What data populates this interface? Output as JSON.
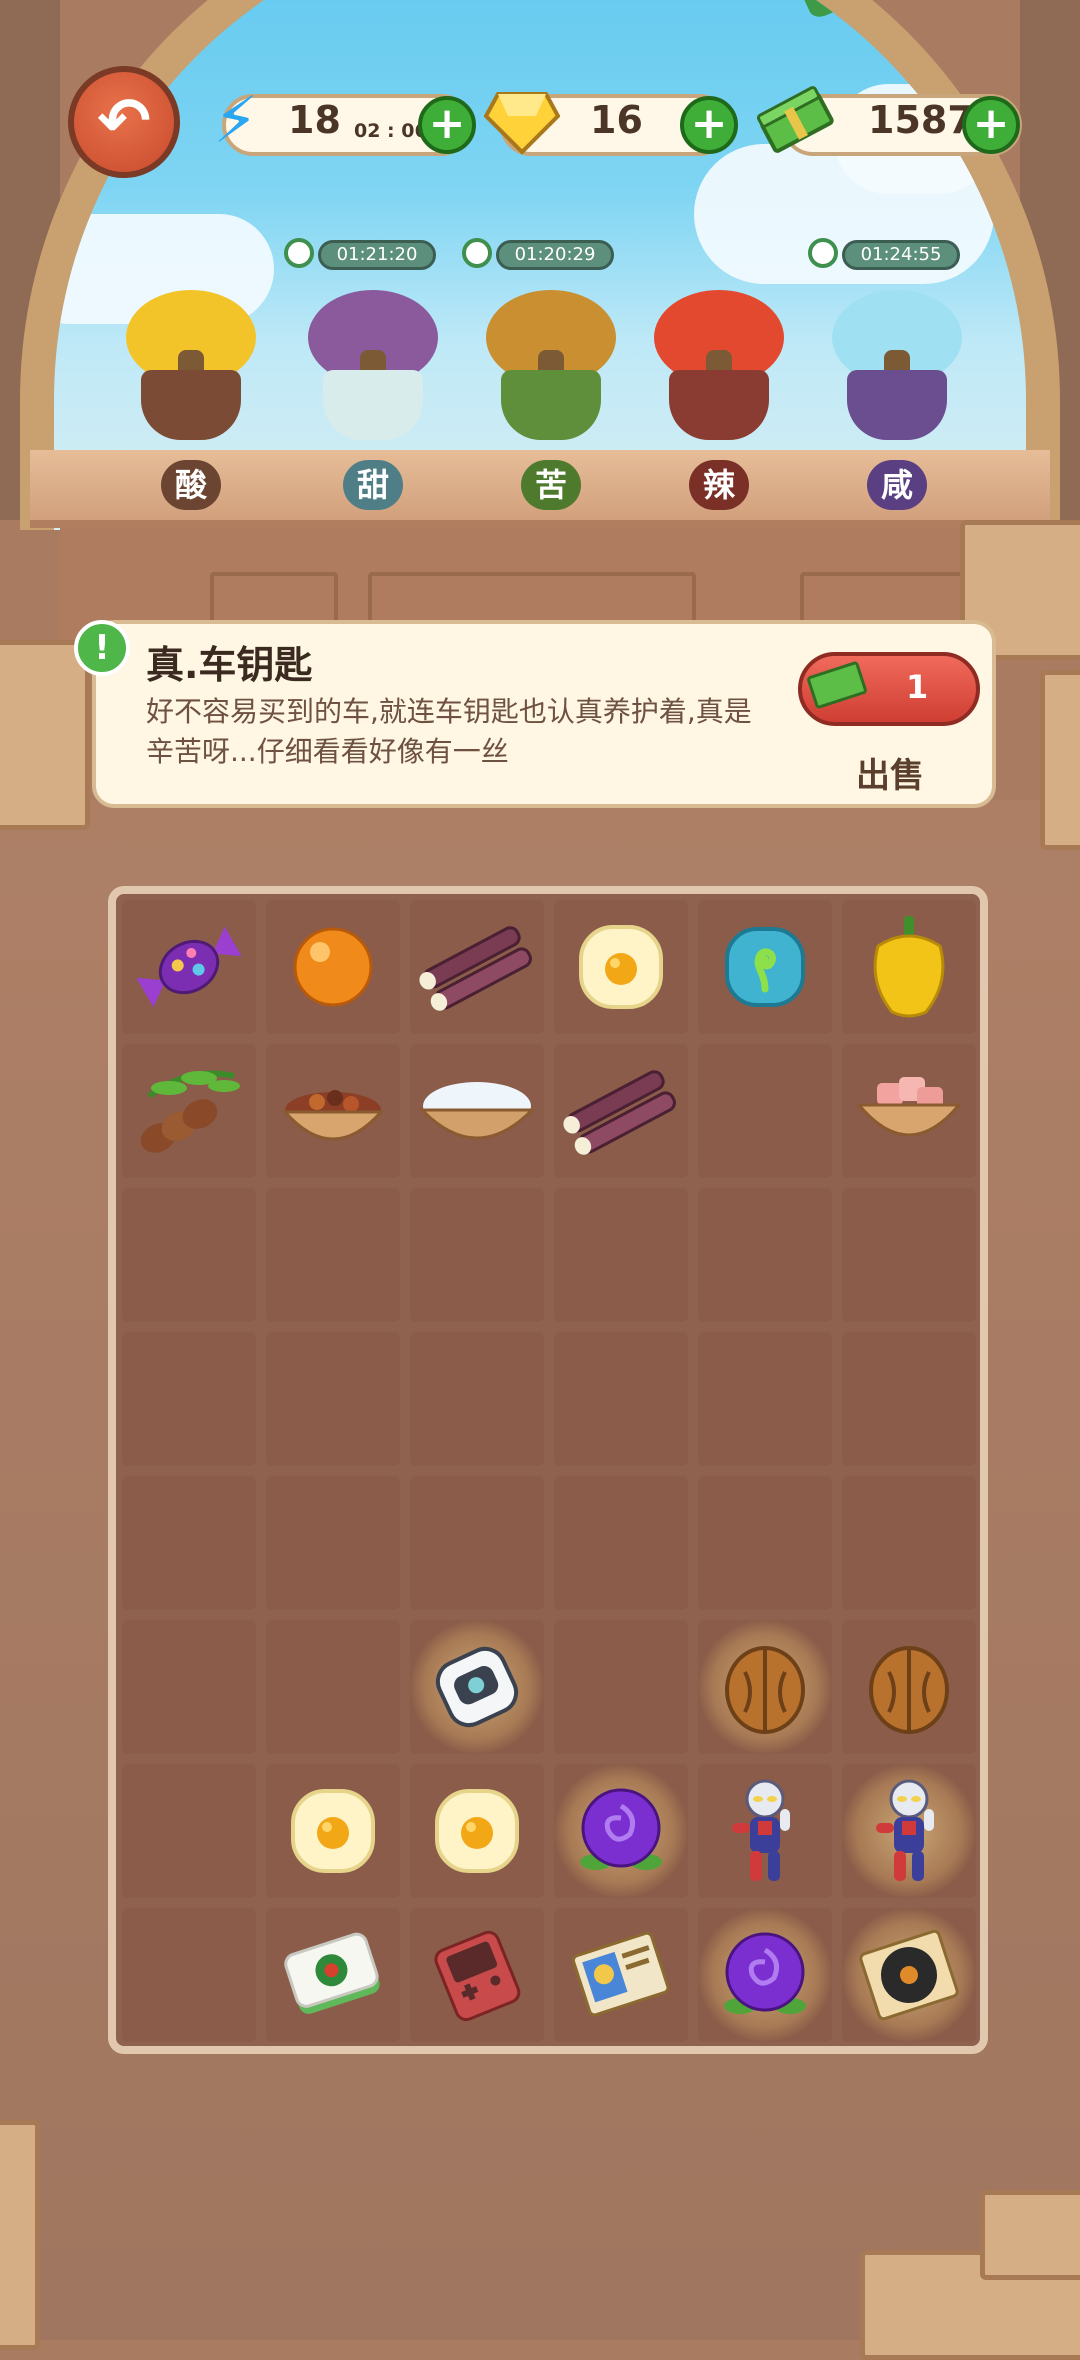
{
  "resources": {
    "energy": {
      "value": "18",
      "timer": "02 : 06",
      "icon": "lightning-icon"
    },
    "gems": {
      "value": "16",
      "icon": "yellow-gem-icon"
    },
    "cash": {
      "value": "1587",
      "icon": "cash-bundle-icon"
    }
  },
  "plants": [
    {
      "label": "酸",
      "timer": null,
      "color": "#f2c42a"
    },
    {
      "label": "甜",
      "timer": "01:21:20",
      "color": "#8a5a9c"
    },
    {
      "label": "苦",
      "timer": "01:20:29",
      "color": "#c98f30"
    },
    {
      "label": "辣",
      "timer": null,
      "color": "#e2492e"
    },
    {
      "label": "咸",
      "timer": "01:24:55",
      "color": "#9fe0f2"
    }
  ],
  "info": {
    "title": "真.车钥匙",
    "description": "好不容易买到的车,就连车钥匙也认真养护着,真是辛苦呀...仔细看看好像有一丝",
    "sell_price": "1",
    "sell_label": "出售"
  },
  "board": {
    "columns": 6,
    "rows": 8,
    "items": [
      {
        "row": 0,
        "col": 0,
        "name": "purple-candy-icon"
      },
      {
        "row": 0,
        "col": 1,
        "name": "orange-ball-icon"
      },
      {
        "row": 0,
        "col": 2,
        "name": "sugarcane-icon"
      },
      {
        "row": 0,
        "col": 3,
        "name": "egg-bubble-icon"
      },
      {
        "row": 0,
        "col": 4,
        "name": "sprout-bubble-icon"
      },
      {
        "row": 0,
        "col": 5,
        "name": "yellow-pepper-icon"
      },
      {
        "row": 1,
        "col": 0,
        "name": "tamarind-icon"
      },
      {
        "row": 1,
        "col": 1,
        "name": "spice-bowl-icon"
      },
      {
        "row": 1,
        "col": 2,
        "name": "salt-bowl-icon"
      },
      {
        "row": 1,
        "col": 3,
        "name": "sugarcane-icon"
      },
      {
        "row": 1,
        "col": 5,
        "name": "meat-bowl-icon"
      },
      {
        "row": 5,
        "col": 2,
        "name": "car-key-icon",
        "glow": true
      },
      {
        "row": 5,
        "col": 4,
        "name": "walnut-icon",
        "glow": true
      },
      {
        "row": 5,
        "col": 5,
        "name": "walnut-icon"
      },
      {
        "row": 6,
        "col": 1,
        "name": "egg-bubble-icon"
      },
      {
        "row": 6,
        "col": 2,
        "name": "egg-bubble-icon"
      },
      {
        "row": 6,
        "col": 3,
        "name": "purple-rose-icon",
        "glow": true
      },
      {
        "row": 6,
        "col": 4,
        "name": "hero-figure-icon"
      },
      {
        "row": 6,
        "col": 5,
        "name": "hero-figure-icon",
        "glow": true
      },
      {
        "row": 7,
        "col": 1,
        "name": "mahjong-tile-icon"
      },
      {
        "row": 7,
        "col": 2,
        "name": "game-console-icon"
      },
      {
        "row": 7,
        "col": 3,
        "name": "trading-card-icon"
      },
      {
        "row": 7,
        "col": 4,
        "name": "purple-rose-icon",
        "glow": true
      },
      {
        "row": 7,
        "col": 5,
        "name": "vinyl-record-icon",
        "glow": true
      }
    ]
  }
}
